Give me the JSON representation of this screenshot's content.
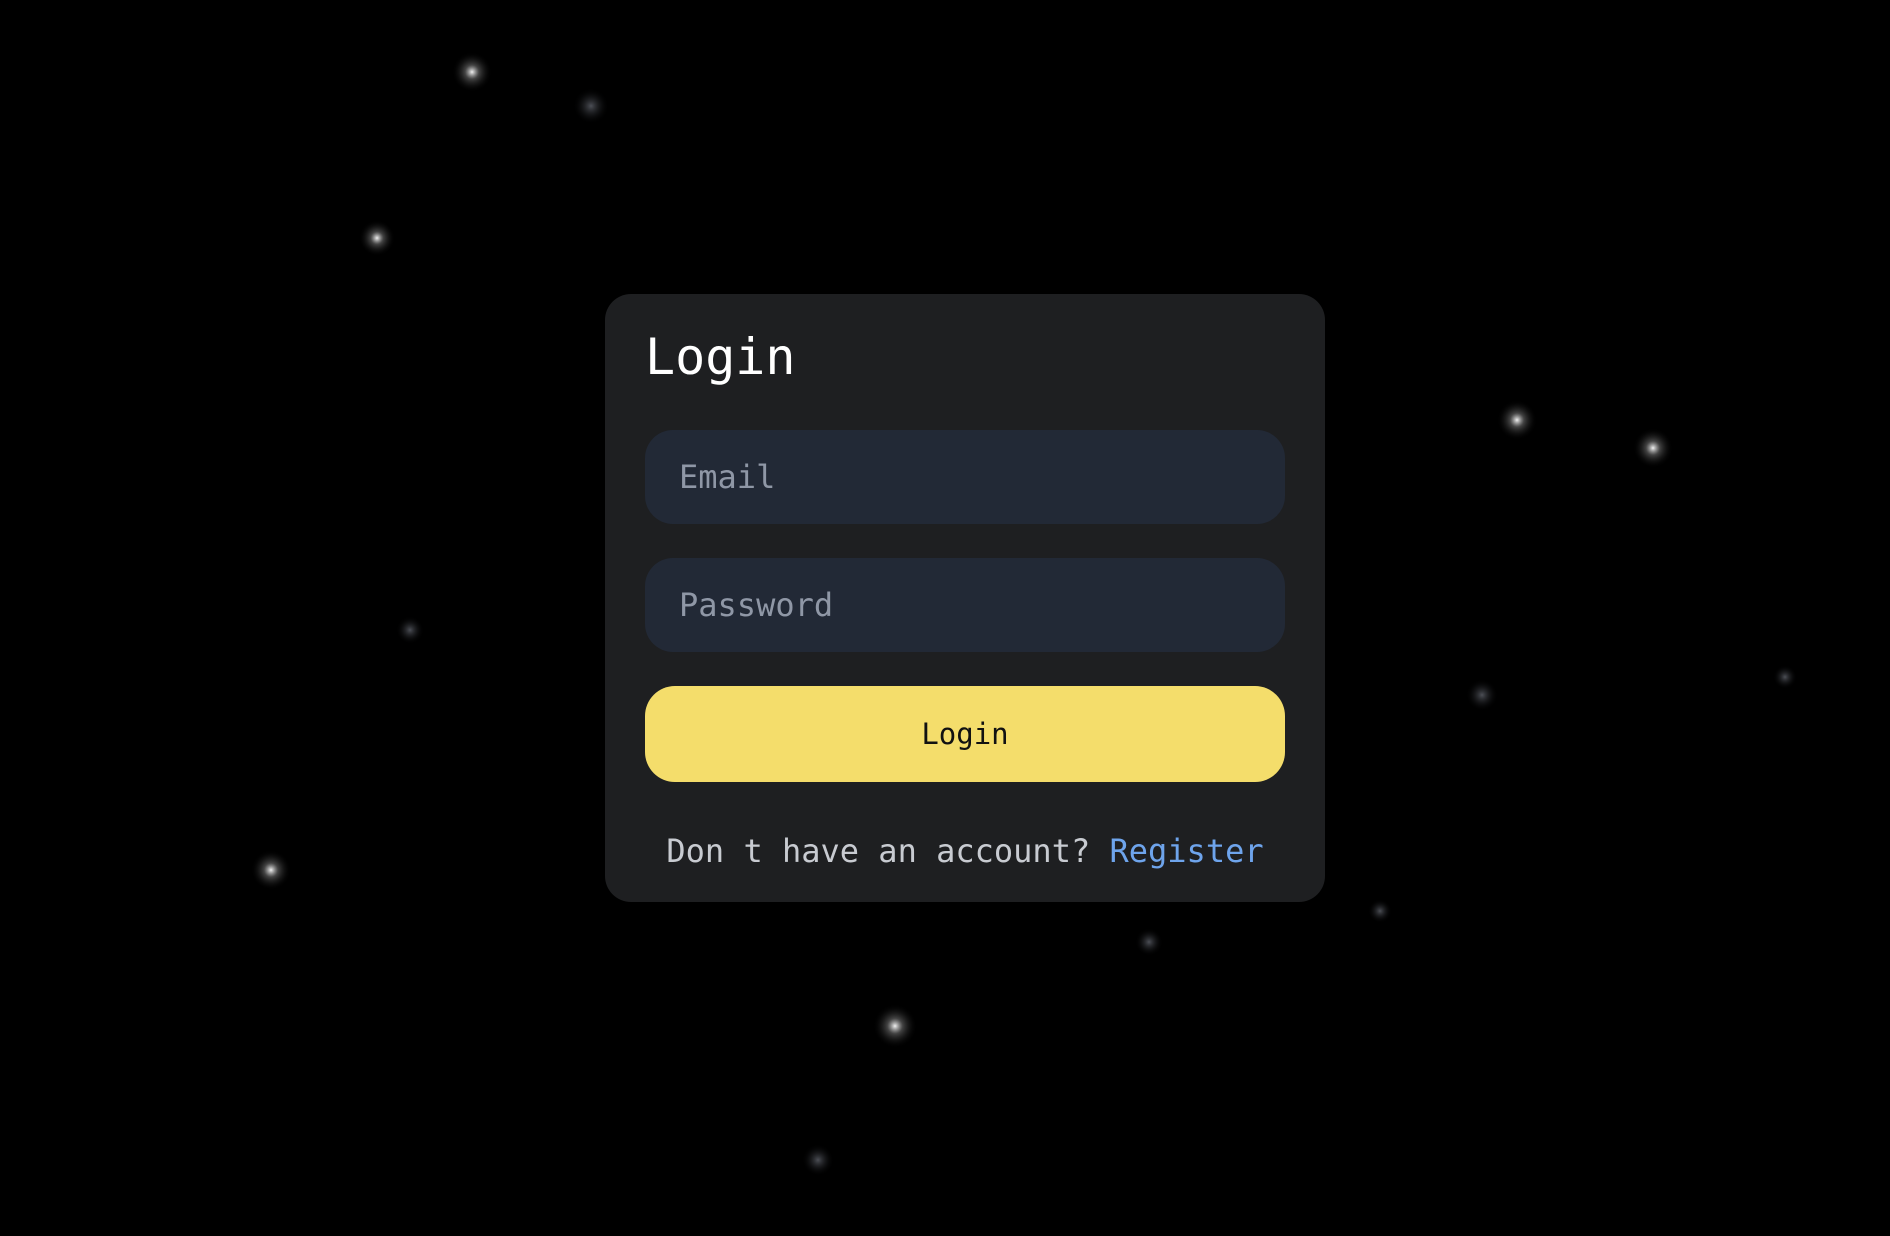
{
  "login_card": {
    "title": "Login",
    "email_placeholder": "Email",
    "password_placeholder": "Password",
    "submit_label": "Login",
    "footer_text": "Don t have an account?",
    "register_label": "Register"
  },
  "colors": {
    "background": "#000000",
    "card": "#1e1f21",
    "input": "#222936",
    "button": "#f4dd6b",
    "link": "#6ea4ec"
  }
}
